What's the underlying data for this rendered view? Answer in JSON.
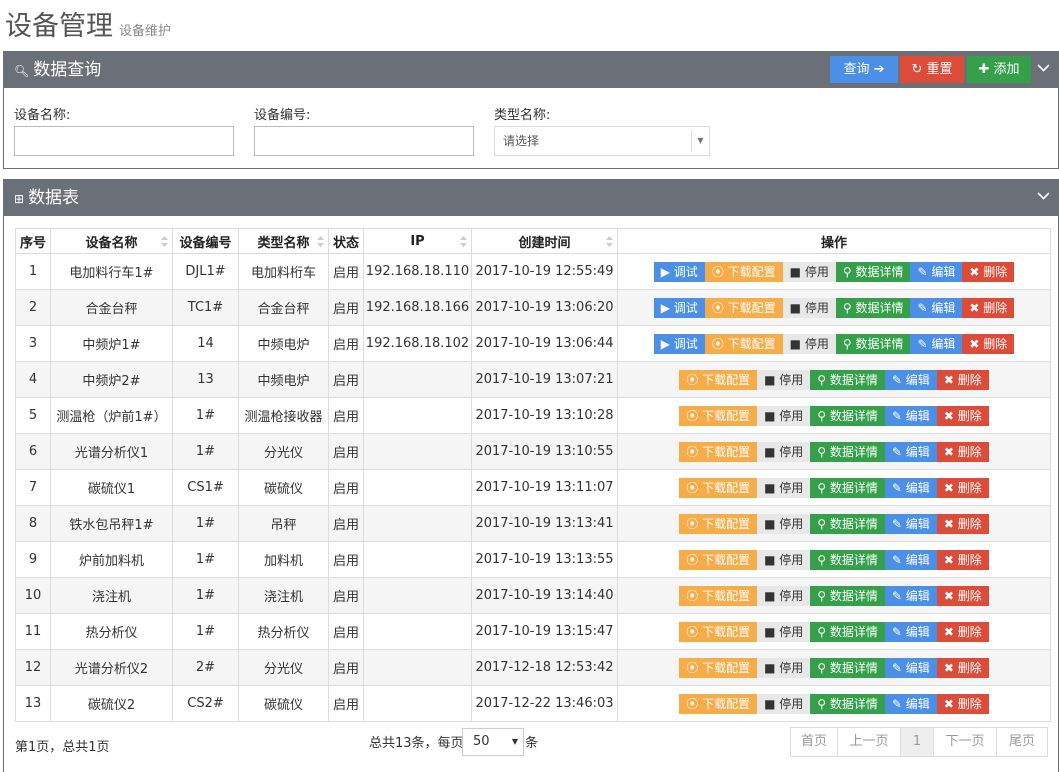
{
  "header": {
    "title": "设备管理",
    "subtitle": "设备维护"
  },
  "query_panel": {
    "title": "数据查询",
    "buttons": {
      "query": "查询",
      "reset": "重置",
      "add": "添加"
    },
    "fields": {
      "name_label": "设备名称:",
      "code_label": "设备编号:",
      "type_label": "类型名称:",
      "type_value": "请选择"
    }
  },
  "table_panel": {
    "title": "数据表",
    "columns": [
      "序号",
      "设备名称",
      "设备编号",
      "类型名称",
      "状态",
      "IP",
      "创建时间",
      "操作"
    ],
    "ops": {
      "debug": "调试",
      "download": "下载配置",
      "disable": "停用",
      "detail": "数据详情",
      "edit": "编辑",
      "delete": "删除"
    },
    "rows": [
      {
        "no": "1",
        "name": "电加料行车1#",
        "code": "DJL1#",
        "type": "电加料桁车",
        "status": "启用",
        "ip": "192.168.18.110",
        "time": "2017-10-19 12:55:49",
        "debug": true
      },
      {
        "no": "2",
        "name": "合金台秤",
        "code": "TC1#",
        "type": "合金台秤",
        "status": "启用",
        "ip": "192.168.18.166",
        "time": "2017-10-19 13:06:20",
        "debug": true
      },
      {
        "no": "3",
        "name": "中频炉1#",
        "code": "14",
        "type": "中频电炉",
        "status": "启用",
        "ip": "192.168.18.102",
        "time": "2017-10-19 13:06:44",
        "debug": true
      },
      {
        "no": "4",
        "name": "中频炉2#",
        "code": "13",
        "type": "中频电炉",
        "status": "启用",
        "ip": "",
        "time": "2017-10-19 13:07:21",
        "debug": false
      },
      {
        "no": "5",
        "name": "测温枪（炉前1#）",
        "code": "1#",
        "type": "测温枪接收器",
        "status": "启用",
        "ip": "",
        "time": "2017-10-19 13:10:28",
        "debug": false
      },
      {
        "no": "6",
        "name": "光谱分析仪1",
        "code": "1#",
        "type": "分光仪",
        "status": "启用",
        "ip": "",
        "time": "2017-10-19 13:10:55",
        "debug": false
      },
      {
        "no": "7",
        "name": "碳硫仪1",
        "code": "CS1#",
        "type": "碳硫仪",
        "status": "启用",
        "ip": "",
        "time": "2017-10-19 13:11:07",
        "debug": false
      },
      {
        "no": "8",
        "name": "铁水包吊秤1#",
        "code": "1#",
        "type": "吊秤",
        "status": "启用",
        "ip": "",
        "time": "2017-10-19 13:13:41",
        "debug": false
      },
      {
        "no": "9",
        "name": "炉前加料机",
        "code": "1#",
        "type": "加料机",
        "status": "启用",
        "ip": "",
        "time": "2017-10-19 13:13:55",
        "debug": false
      },
      {
        "no": "10",
        "name": "浇注机",
        "code": "1#",
        "type": "浇注机",
        "status": "启用",
        "ip": "",
        "time": "2017-10-19 13:14:40",
        "debug": false
      },
      {
        "no": "11",
        "name": "热分析仪",
        "code": "1#",
        "type": "热分析仪",
        "status": "启用",
        "ip": "",
        "time": "2017-10-19 13:15:47",
        "debug": false
      },
      {
        "no": "12",
        "name": "光谱分析仪2",
        "code": "2#",
        "type": "分光仪",
        "status": "启用",
        "ip": "",
        "time": "2017-12-18 12:53:42",
        "debug": false
      },
      {
        "no": "13",
        "name": "碳硫仪2",
        "code": "CS2#",
        "type": "碳硫仪",
        "status": "启用",
        "ip": "",
        "time": "2017-12-22 13:46:03",
        "debug": false
      }
    ]
  },
  "pagination": {
    "page_info": "第1页，总共1页",
    "total_text": "总共13条，每页",
    "page_size": "50",
    "unit": "条",
    "first": "首页",
    "prev": "上一页",
    "current": "1",
    "next": "下一页",
    "last": "尾页"
  }
}
